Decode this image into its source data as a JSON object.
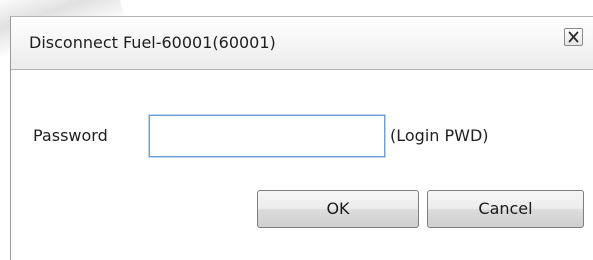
{
  "dialog": {
    "title": "Disconnect Fuel-60001(60001)",
    "close_icon": "close-icon"
  },
  "form": {
    "password_label": "Password",
    "password_value": "",
    "password_placeholder": "",
    "hint": "(Login PWD)"
  },
  "buttons": {
    "ok_label": "OK",
    "cancel_label": "Cancel"
  },
  "colors": {
    "input_border": "#6f9fd6",
    "title_bar_bottom": "#ececec",
    "button_border": "#7e7e7e"
  }
}
